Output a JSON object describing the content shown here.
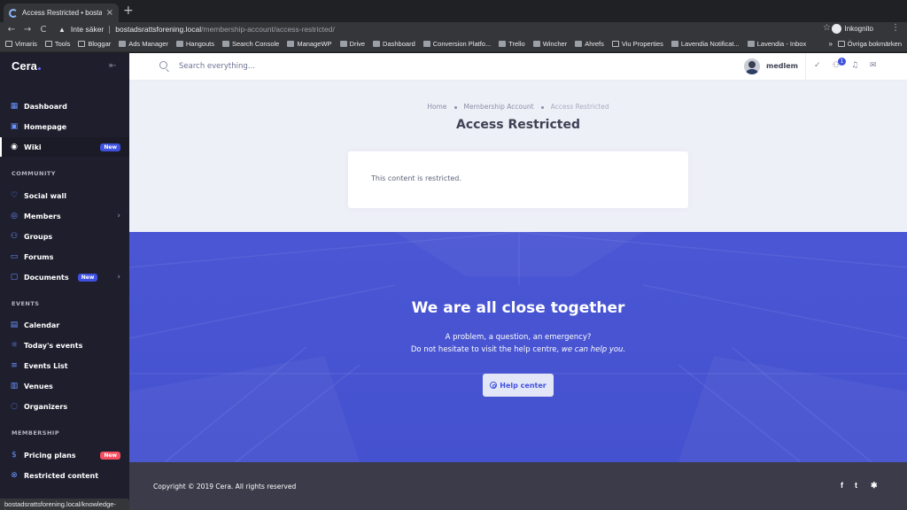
{
  "browser": {
    "tab_title": "Access Restricted • bostadsrä",
    "tab_close": "×",
    "new_tab": "+",
    "back": "←",
    "forward": "→",
    "reload": "C",
    "security_icon": "warning-triangle",
    "security_text": "Inte säker",
    "url_host": "bostadsrattsforening.local",
    "url_path": "/membership-account/access-restricted/",
    "star": "☆",
    "incognito_label": "Inkognito",
    "menu": "⋮"
  },
  "bookmarks": {
    "items": [
      {
        "label": "Vimaris",
        "icon": "folder"
      },
      {
        "label": "Tools",
        "icon": "folder"
      },
      {
        "label": "Bloggar",
        "icon": "folder"
      },
      {
        "label": "Ads Manager",
        "icon": "page"
      },
      {
        "label": "Hangouts",
        "icon": "page"
      },
      {
        "label": "Search Console",
        "icon": "page"
      },
      {
        "label": "ManageWP",
        "icon": "page"
      },
      {
        "label": "Drive",
        "icon": "page"
      },
      {
        "label": "Dashboard",
        "icon": "page"
      },
      {
        "label": "Conversion Platfo...",
        "icon": "page"
      },
      {
        "label": "Trello",
        "icon": "page"
      },
      {
        "label": "Wincher",
        "icon": "page"
      },
      {
        "label": "Ahrefs",
        "icon": "page"
      },
      {
        "label": "Viu Properties",
        "icon": "folder"
      },
      {
        "label": "Lavendia Notificat...",
        "icon": "page"
      },
      {
        "label": "Lavendia - Inbox",
        "icon": "page"
      }
    ],
    "more": "»",
    "other": "Övriga bokmärken"
  },
  "sidebar": {
    "logo": "Cera",
    "collapse": "⇤",
    "items": [
      {
        "label": "Dashboard",
        "icon": "▦"
      },
      {
        "label": "Homepage",
        "icon": "▣"
      },
      {
        "label": "Wiki",
        "icon": "◉",
        "badge": "New"
      },
      {
        "label": "Social wall",
        "icon": "♡"
      },
      {
        "label": "Members",
        "icon": "◎",
        "chevron": "›"
      },
      {
        "label": "Groups",
        "icon": "⚇"
      },
      {
        "label": "Forums",
        "icon": "▭"
      },
      {
        "label": "Documents",
        "icon": "▢",
        "badge": "New",
        "chevron": "›"
      },
      {
        "label": "Calendar",
        "icon": "▤"
      },
      {
        "label": "Today's events",
        "icon": "☼"
      },
      {
        "label": "Events List",
        "icon": "≡"
      },
      {
        "label": "Venues",
        "icon": "▥"
      },
      {
        "label": "Organizers",
        "icon": "◌"
      },
      {
        "label": "Pricing plans",
        "icon": "$",
        "badge": "New"
      },
      {
        "label": "Restricted content",
        "icon": "⊗"
      }
    ],
    "sections": {
      "community": "COMMUNITY",
      "events": "EVENTS",
      "membership": "MEMBERSHIP"
    },
    "status_url": "bostadsrattsforening.local/knowledge-base"
  },
  "header": {
    "search_placeholder": "Search everything...",
    "user_name": "medlem",
    "check_icon": "✓",
    "friends_icon": "⚇",
    "friends_badge": "1",
    "bell_icon": "♫",
    "mail_icon": "✉"
  },
  "main": {
    "breadcrumb": [
      "Home",
      "Membership Account",
      "Access Restricted"
    ],
    "title": "Access Restricted",
    "card_text": "This content is restricted."
  },
  "banner": {
    "title": "We are all close together",
    "line1": "A problem, a question, an emergency?",
    "line2_prefix": "Do not hesitate to visit the help centre, ",
    "line2_emphasis": "we can help you.",
    "button_label": "Help center"
  },
  "footer": {
    "copyright": "Copyright © 2019 Cera. All rights reserved",
    "facebook": "f",
    "twitter": "t",
    "slack": "✱"
  },
  "colors": {
    "sidebar_bg": "#1e1e2d",
    "accent": "#3f51e0",
    "banner_bg": "#4a56d4",
    "content_bg": "#eef0f8",
    "footer_bg": "#3b3b4a",
    "badge_red": "#f64e60"
  }
}
